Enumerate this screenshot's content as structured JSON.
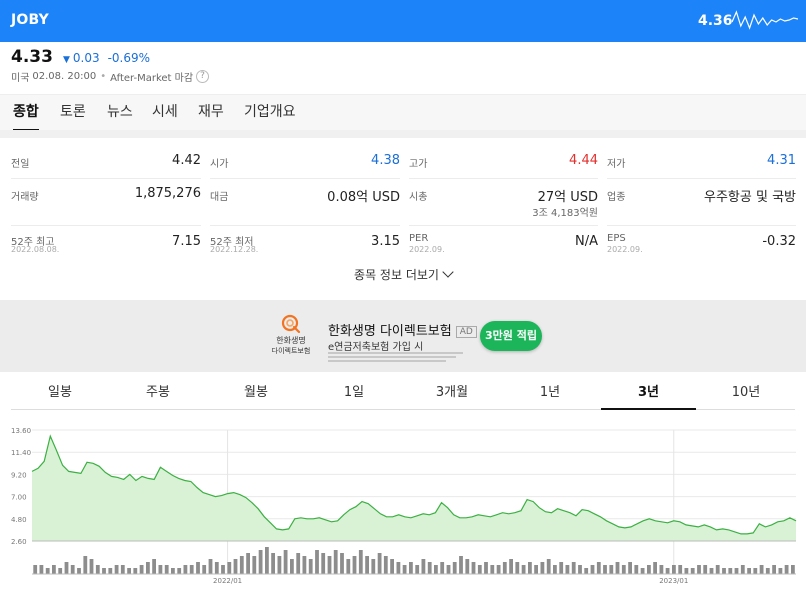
{
  "header": {
    "ticker": "JOBY",
    "price": "4.36",
    "spark_y": [
      16,
      6,
      20,
      11,
      22,
      9,
      18,
      12,
      19,
      14,
      16,
      13,
      15,
      14,
      12,
      13
    ]
  },
  "summary": {
    "price": "4.33",
    "arrow": "▼",
    "change": "0.03",
    "change_pct": "-0.69%",
    "market": "미국",
    "datetime": "02.08. 20:00",
    "session": "After-Market 마감",
    "help": "?"
  },
  "tabs": [
    "종합",
    "토론",
    "뉴스",
    "시세",
    "재무",
    "기업개요"
  ],
  "active_tab": 0,
  "stats": {
    "prev_close": {
      "label": "전일",
      "value": "4.42"
    },
    "open": {
      "label": "시가",
      "value": "4.38"
    },
    "high": {
      "label": "고가",
      "value": "4.44"
    },
    "low": {
      "label": "저가",
      "value": "4.31"
    },
    "volume": {
      "label": "거래량",
      "value": "1,875,276"
    },
    "amount": {
      "label": "대금",
      "value": "0.08억 USD"
    },
    "market_cap": {
      "label": "시총",
      "value": "27억 USD",
      "value2": "3조 4,183억원"
    },
    "sector": {
      "label": "업종",
      "value": "우주항공 및 국방"
    },
    "high52": {
      "label": "52주 최고",
      "date": "2022.08.08.",
      "value": "7.15"
    },
    "low52": {
      "label": "52주 최저",
      "date": "2022.12.28.",
      "value": "3.15"
    },
    "per": {
      "label": "PER",
      "date": "2022.09.",
      "value": "N/A"
    },
    "eps": {
      "label": "EPS",
      "date": "2022.09.",
      "value": "-0.32"
    }
  },
  "more_label": "종목 정보 더보기",
  "ad": {
    "brand_line1": "한화생명",
    "brand_line2": "다이렉트보험",
    "title": "한화생명 다이렉트보험",
    "badge": "AD",
    "subtitle": "e연금저축보험 가입 시",
    "button": "3만원 적립"
  },
  "periods": [
    "일봉",
    "주봉",
    "월봉",
    "1일",
    "3개월",
    "1년",
    "3년",
    "10년"
  ],
  "active_period": 6,
  "colors": {
    "header_bg": "#1c84f8",
    "up": "#e2312d",
    "down": "#1a6fd8",
    "area_fill": "#d9f2d6",
    "line": "#3cb043",
    "volume_bar": "#8d8d8d",
    "ad_button": "#1db55a"
  },
  "chart_data": {
    "type": "area",
    "y_ticks": [
      "13.60",
      "11.40",
      "9.20",
      "7.00",
      "4.80",
      "2.60"
    ],
    "ylim": [
      2.6,
      13.6
    ],
    "x_ticks": [
      {
        "label": "2022/01",
        "index": 32
      },
      {
        "label": "2023/01",
        "index": 105
      }
    ],
    "price": [
      9.5,
      9.8,
      10.5,
      13.0,
      11.6,
      10.1,
      9.5,
      9.4,
      9.3,
      10.4,
      10.3,
      10.0,
      9.4,
      9.0,
      8.9,
      8.7,
      9.2,
      8.6,
      9.0,
      8.8,
      8.7,
      9.9,
      9.5,
      9.1,
      8.8,
      8.6,
      8.5,
      7.9,
      7.4,
      7.2,
      7.0,
      7.1,
      7.3,
      7.4,
      7.2,
      6.9,
      6.4,
      5.8,
      5.0,
      4.4,
      3.8,
      3.7,
      3.8,
      4.8,
      4.9,
      4.8,
      4.8,
      4.9,
      4.7,
      4.5,
      4.6,
      5.2,
      5.7,
      6.0,
      6.5,
      6.3,
      5.8,
      5.3,
      5.0,
      5.0,
      5.2,
      5.0,
      4.9,
      5.1,
      5.3,
      5.2,
      5.4,
      6.4,
      5.9,
      5.2,
      4.9,
      4.9,
      5.0,
      5.2,
      5.1,
      5.0,
      5.2,
      5.4,
      5.3,
      5.4,
      5.6,
      6.7,
      6.5,
      5.9,
      5.5,
      5.4,
      5.8,
      5.6,
      5.4,
      5.1,
      5.7,
      5.6,
      5.3,
      5.0,
      4.6,
      4.3,
      4.0,
      3.9,
      4.0,
      4.3,
      4.6,
      4.8,
      4.6,
      4.5,
      4.4,
      4.6,
      4.5,
      4.2,
      4.1,
      4.0,
      4.2,
      4.0,
      3.7,
      3.8,
      3.7,
      3.5,
      3.3,
      3.3,
      3.4,
      4.3,
      4.0,
      4.2,
      4.5,
      4.6,
      4.9,
      4.6
    ],
    "volume": [
      3,
      3,
      2,
      3,
      2,
      4,
      3,
      2,
      6,
      5,
      3,
      2,
      2,
      3,
      3,
      2,
      2,
      3,
      4,
      5,
      3,
      3,
      2,
      2,
      3,
      3,
      4,
      3,
      5,
      4,
      3,
      4,
      5,
      6,
      7,
      6,
      8,
      9,
      7,
      6,
      8,
      5,
      7,
      6,
      5,
      8,
      7,
      6,
      8,
      7,
      5,
      6,
      8,
      6,
      5,
      7,
      6,
      5,
      4,
      3,
      4,
      3,
      5,
      4,
      3,
      4,
      3,
      4,
      6,
      5,
      4,
      3,
      4,
      3,
      3,
      4,
      5,
      4,
      3,
      4,
      3,
      4,
      5,
      3,
      4,
      3,
      4,
      3,
      2,
      3,
      4,
      3,
      3,
      4,
      3,
      4,
      3,
      2,
      3,
      4,
      3,
      2,
      3,
      3,
      2,
      2,
      3,
      3,
      2,
      3,
      2,
      2,
      2,
      3,
      2,
      2,
      3,
      2,
      3,
      2,
      3,
      3
    ]
  }
}
